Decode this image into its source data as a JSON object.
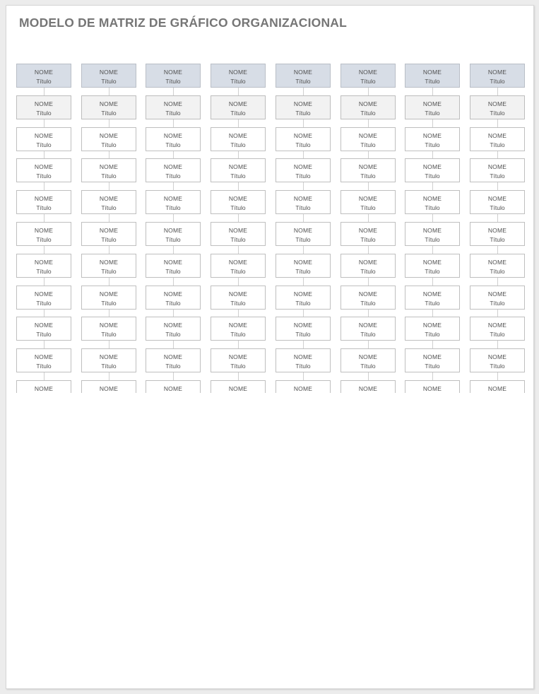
{
  "document": {
    "title": "MODELO DE MATRIZ DE GRÁFICO ORGANIZACIONAL",
    "colors": {
      "header_row_fill": "#d7dde6",
      "second_row_fill": "#f2f2f2",
      "default_fill": "#ffffff",
      "border": "#bfbfbf",
      "connector": "#cfcfcf",
      "title_text": "#767676"
    }
  },
  "matrix": {
    "columns": 8,
    "rows_visible": 11,
    "last_row_truncated": true,
    "row_fills": [
      "header",
      "secondary",
      "default",
      "default",
      "default",
      "default",
      "default",
      "default",
      "default",
      "default",
      "default"
    ],
    "cell": {
      "name_label": "NOME",
      "title_label": "Título"
    }
  }
}
